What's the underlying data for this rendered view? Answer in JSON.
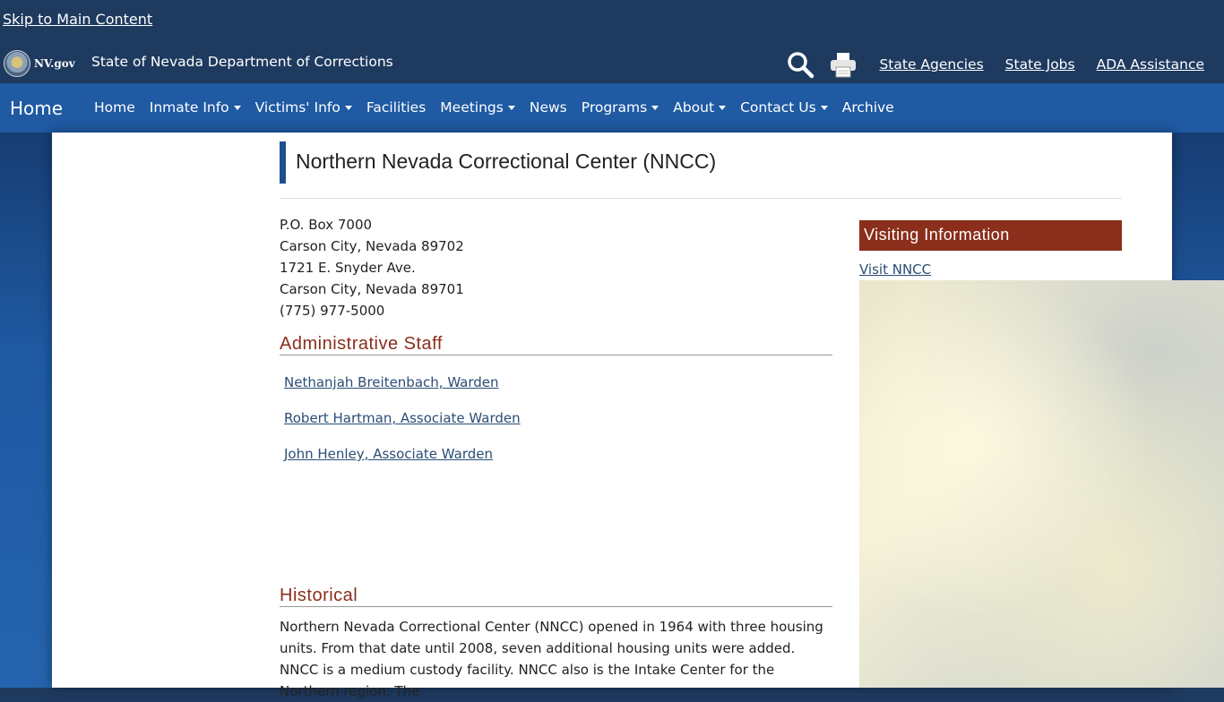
{
  "header": {
    "skip_link": "Skip to Main Content",
    "nvgov_logo": "NV.gov",
    "agency_name": "State of Nevada Department of Corrections",
    "util_links": [
      "State Agencies",
      "State Jobs",
      "ADA Assistance"
    ],
    "icons": [
      "search-icon",
      "printer-icon"
    ]
  },
  "nav": {
    "brand": "Home",
    "items": [
      {
        "label": "Home",
        "dropdown": false
      },
      {
        "label": "Inmate Info",
        "dropdown": true
      },
      {
        "label": "Victims' Info",
        "dropdown": true
      },
      {
        "label": "Facilities",
        "dropdown": false
      },
      {
        "label": "Meetings",
        "dropdown": true
      },
      {
        "label": "News",
        "dropdown": false
      },
      {
        "label": "Programs",
        "dropdown": true
      },
      {
        "label": "About",
        "dropdown": true
      },
      {
        "label": "Contact Us",
        "dropdown": true
      },
      {
        "label": "Archive",
        "dropdown": false
      }
    ]
  },
  "main": {
    "title": "Northern Nevada Correctional Center (NNCC)",
    "address": [
      "P.O. Box 7000",
      "Carson City, Nevada 89702",
      "1721 E. Snyder Ave.",
      "Carson City, Nevada 89701",
      "(775) 977-5000"
    ],
    "admin_heading": "Administrative Staff",
    "staff": [
      "Nethanjah Breitenbach, Warden",
      "Robert Hartman, Associate Warden",
      "John Henley, Associate Warden"
    ],
    "historical_heading": "Historical",
    "historical_text": "Northern Nevada Correctional Center (NNCC) opened in 1964 with three housing units. From that date until 2008, seven additional housing units were added. NNCC is a medium custody facility. NNCC also is the Intake Center for the Northern region. The"
  },
  "sidebar": {
    "visiting_heading": "Visiting Information",
    "visit_link": "Visit NNCC"
  },
  "colors": {
    "header_bg": "#1e3a5f",
    "nav_bg": "#1f5aa3",
    "accent_red": "#8b2e1c",
    "title_bar": "#1f4f8c",
    "link": "#2a4d76"
  }
}
